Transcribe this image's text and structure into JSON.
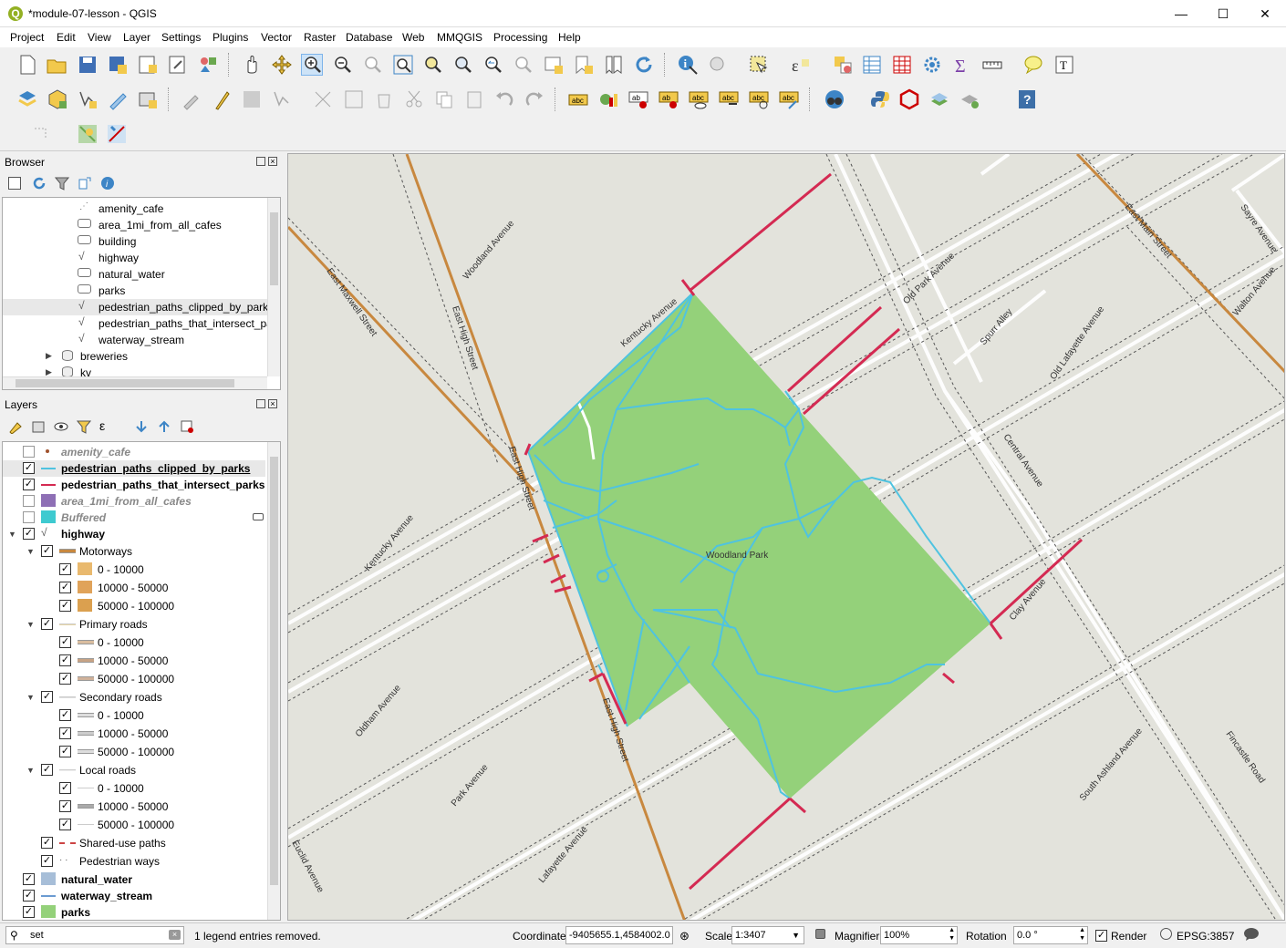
{
  "window": {
    "title": "*module-07-lesson - QGIS",
    "minimize": "—",
    "maximize": "☐",
    "close": "✕"
  },
  "menu": [
    "Project",
    "Edit",
    "View",
    "Layer",
    "Settings",
    "Plugins",
    "Vector",
    "Raster",
    "Database",
    "Web",
    "MMQGIS",
    "Processing",
    "Help"
  ],
  "browser": {
    "title": "Browser",
    "items": [
      {
        "label": "amenity_cafe",
        "icon": "point-layer-icon"
      },
      {
        "label": "area_1mi_from_all_cafes",
        "icon": "polygon-layer-icon"
      },
      {
        "label": "building",
        "icon": "polygon-layer-icon"
      },
      {
        "label": "highway",
        "icon": "line-layer-icon"
      },
      {
        "label": "natural_water",
        "icon": "polygon-layer-icon"
      },
      {
        "label": "parks",
        "icon": "polygon-layer-icon"
      },
      {
        "label": "pedestrian_paths_clipped_by_parks",
        "icon": "line-layer-icon"
      },
      {
        "label": "pedestrian_paths_that_intersect_par",
        "icon": "line-layer-icon"
      },
      {
        "label": "waterway_stream",
        "icon": "line-layer-icon"
      },
      {
        "label": "breweries",
        "icon": "database-icon"
      },
      {
        "label": "kv",
        "icon": "database-icon"
      }
    ]
  },
  "layers": {
    "title": "Layers",
    "items": [
      {
        "label": "amenity_cafe",
        "checked": false,
        "style": "italic-gray"
      },
      {
        "label": "pedestrian_paths_clipped_by_parks",
        "checked": true,
        "style": "bold-underline"
      },
      {
        "label": "pedestrian_paths_that_intersect_parks",
        "checked": true,
        "style": "bold"
      },
      {
        "label": "area_1mi_from_all_cafes",
        "checked": false,
        "style": "italic-gray"
      },
      {
        "label": "Buffered",
        "checked": false,
        "style": "italic-gray"
      },
      {
        "label": "highway",
        "checked": true,
        "style": "bold"
      },
      {
        "label": "Motorways",
        "checked": true,
        "style": "normal"
      },
      {
        "label": "0 - 10000",
        "checked": true,
        "style": "normal"
      },
      {
        "label": "10000 - 50000",
        "checked": true,
        "style": "normal"
      },
      {
        "label": "50000 - 100000",
        "checked": true,
        "style": "normal"
      },
      {
        "label": "Primary roads",
        "checked": true,
        "style": "normal"
      },
      {
        "label": "0 - 10000",
        "checked": true,
        "style": "normal"
      },
      {
        "label": "10000 - 50000",
        "checked": true,
        "style": "normal"
      },
      {
        "label": "50000 - 100000",
        "checked": true,
        "style": "normal"
      },
      {
        "label": "Secondary roads",
        "checked": true,
        "style": "normal"
      },
      {
        "label": "0 - 10000",
        "checked": true,
        "style": "normal"
      },
      {
        "label": "10000 - 50000",
        "checked": true,
        "style": "normal"
      },
      {
        "label": "50000 - 100000",
        "checked": true,
        "style": "normal"
      },
      {
        "label": "Local roads",
        "checked": true,
        "style": "normal"
      },
      {
        "label": "0 - 10000",
        "checked": true,
        "style": "normal"
      },
      {
        "label": "10000 - 50000",
        "checked": true,
        "style": "normal"
      },
      {
        "label": "50000 - 100000",
        "checked": true,
        "style": "normal"
      },
      {
        "label": "Shared-use paths",
        "checked": true,
        "style": "normal"
      },
      {
        "label": "Pedestrian ways",
        "checked": true,
        "style": "normal"
      },
      {
        "label": "natural_water",
        "checked": true,
        "style": "bold"
      },
      {
        "label": "waterway_stream",
        "checked": true,
        "style": "bold"
      },
      {
        "label": "parks",
        "checked": true,
        "style": "bold"
      }
    ]
  },
  "map": {
    "park_label": "Woodland Park",
    "street_labels": [
      "Woodland Avenue",
      "East Maxwell Street",
      "East High Street",
      "Kentucky Avenue",
      "Old Park Avenue",
      "East Main Street",
      "Sayre Avenue",
      "Walton Avenue",
      "Spurr Alley",
      "Old Lafayette Avenue",
      "Central Avenue",
      "Clay Avenue",
      "Oldham Avenue",
      "Park Avenue",
      "Lafayette Avenue",
      "Euclid Avenue",
      "South Ashland Avenue",
      "Fincastle Road"
    ],
    "colors": {
      "park": "#94d17a",
      "paths": "#4fc3e0",
      "intersect": "#d42a52",
      "motorway": "#c8883f",
      "background": "#e3e3dc"
    }
  },
  "status": {
    "search_value": "set",
    "message": "1 legend entries removed.",
    "coordinate_label": "Coordinate",
    "coordinate_value": "-9405655.1,4584002.0",
    "scale_label": "Scale",
    "scale_value": "1:3407",
    "magnifier_label": "Magnifier",
    "magnifier_value": "100%",
    "rotation_label": "Rotation",
    "rotation_value": "0.0 °",
    "render_label": "Render",
    "crs": "EPSG:3857"
  }
}
